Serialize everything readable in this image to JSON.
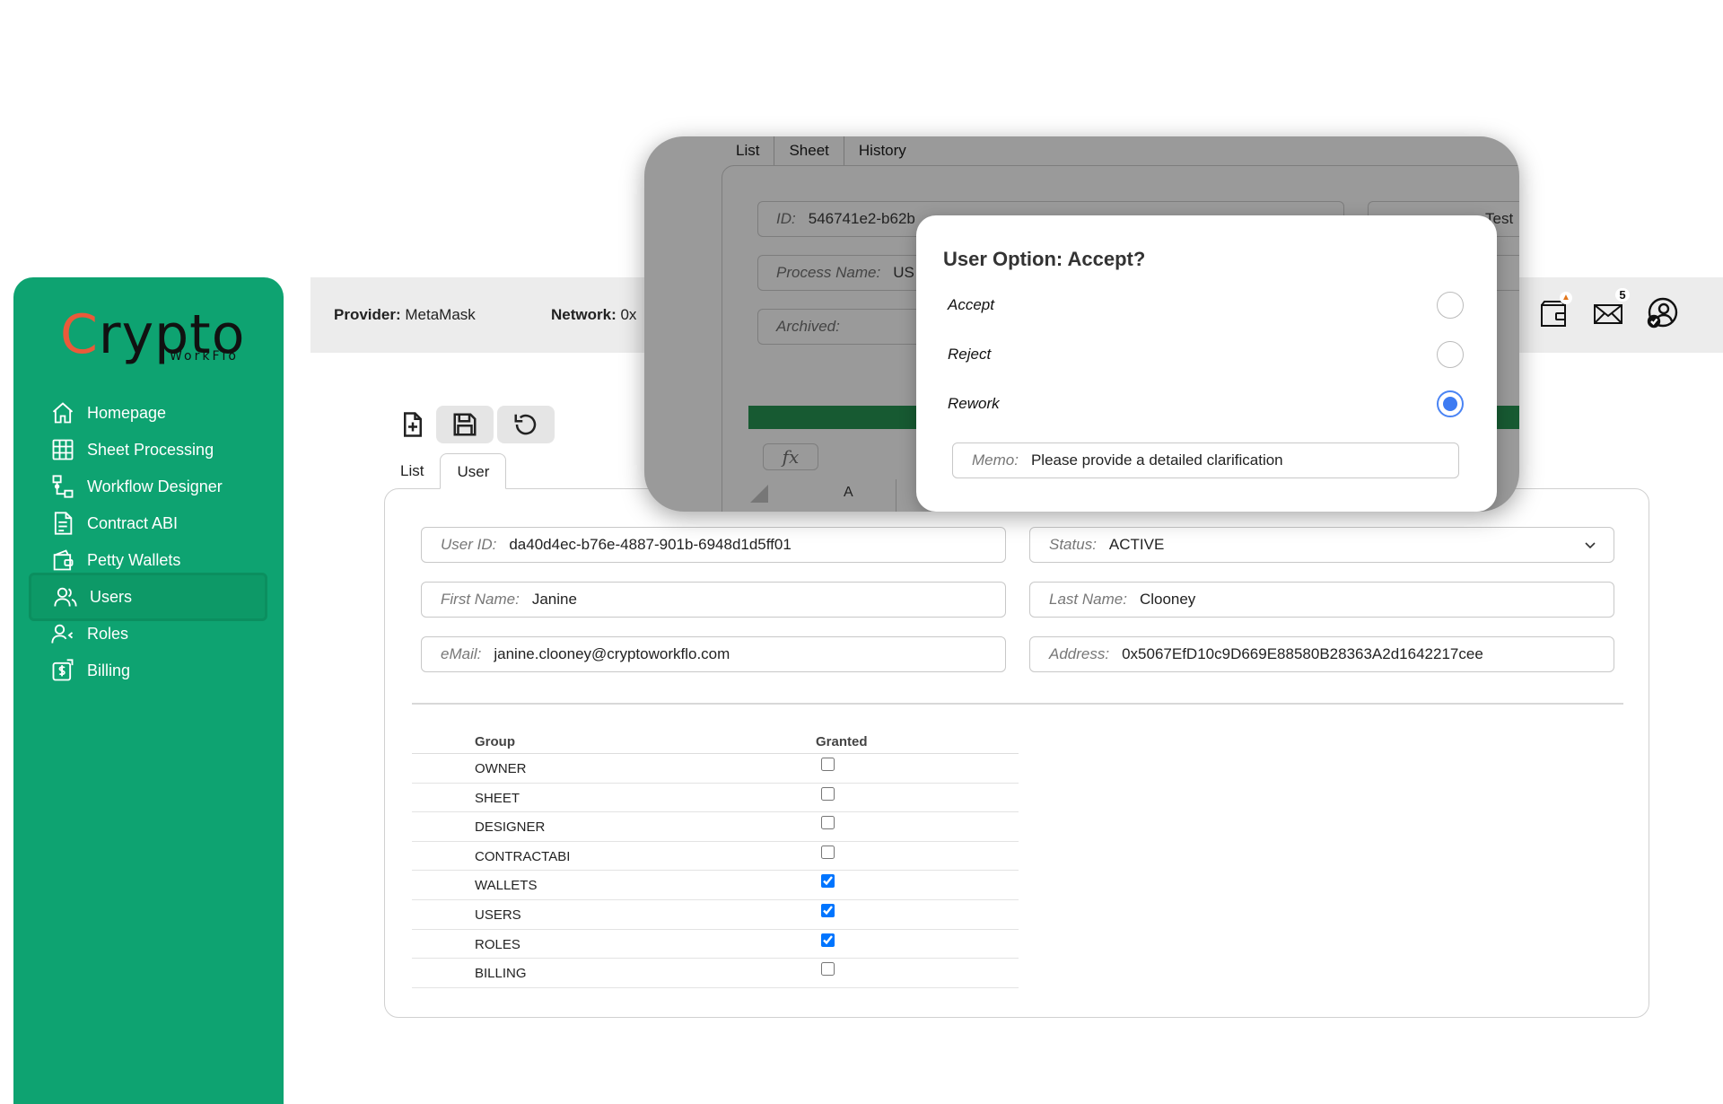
{
  "brand": {
    "logo_main": "rypto",
    "logo_c": "C",
    "logo_sub": "WorkFlo"
  },
  "sidebar": {
    "items": [
      {
        "label": "Homepage",
        "icon": "home-icon"
      },
      {
        "label": "Sheet Processing",
        "icon": "table-icon"
      },
      {
        "label": "Workflow Designer",
        "icon": "workflow-icon"
      },
      {
        "label": "Contract ABI",
        "icon": "document-icon"
      },
      {
        "label": "Petty Wallets",
        "icon": "wallet-icon"
      },
      {
        "label": "Users",
        "icon": "users-icon",
        "active": true
      },
      {
        "label": "Roles",
        "icon": "roles-icon"
      },
      {
        "label": "Billing",
        "icon": "billing-icon"
      }
    ]
  },
  "topbar": {
    "provider_label": "Provider:",
    "provider_value": "MetaMask",
    "network_label": "Network:",
    "network_value": "0x",
    "mail_count": "5"
  },
  "tabs": {
    "list": "List",
    "user": "User"
  },
  "form": {
    "user_id_label": "User ID:",
    "user_id": "da40d4ec-b76e-4887-901b-6948d1d5ff01",
    "status_label": "Status:",
    "status": "ACTIVE",
    "first_name_label": "First Name:",
    "first_name": "Janine",
    "last_name_label": "Last Name:",
    "last_name": "Clooney",
    "email_label": "eMail:",
    "email": "janine.clooney@cryptoworkflo.com",
    "address_label": "Address:",
    "address": "0x5067EfD10c9D669E88580B28363A2d1642217cee"
  },
  "groups": {
    "col_group": "Group",
    "col_granted": "Granted",
    "rows": [
      {
        "name": "OWNER",
        "granted": false
      },
      {
        "name": "SHEET",
        "granted": false
      },
      {
        "name": "DESIGNER",
        "granted": false
      },
      {
        "name": "CONTRACTABI",
        "granted": false
      },
      {
        "name": "WALLETS",
        "granted": true
      },
      {
        "name": "USERS",
        "granted": true
      },
      {
        "name": "ROLES",
        "granted": true
      },
      {
        "name": "BILLING",
        "granted": false
      }
    ]
  },
  "inset": {
    "tabs": [
      "List",
      "Sheet",
      "History"
    ],
    "id_label": "ID:",
    "id_value": "546741e2-b62b",
    "process_label": "Process Name:",
    "process_value": "US",
    "archived_label": "Archived:",
    "description_partial": "Test",
    "fx": "fx",
    "col_a": "A"
  },
  "modal": {
    "title": "User Option: Accept?",
    "options": [
      {
        "label": "Accept",
        "selected": false
      },
      {
        "label": "Reject",
        "selected": false
      },
      {
        "label": "Rework",
        "selected": true
      }
    ],
    "memo_label": "Memo:",
    "memo_value": "Please provide a detailed clarification"
  },
  "colors": {
    "sidebar": "#0ea371",
    "accent": "#3d7bf2",
    "logo_c": "#ea5a3a"
  }
}
